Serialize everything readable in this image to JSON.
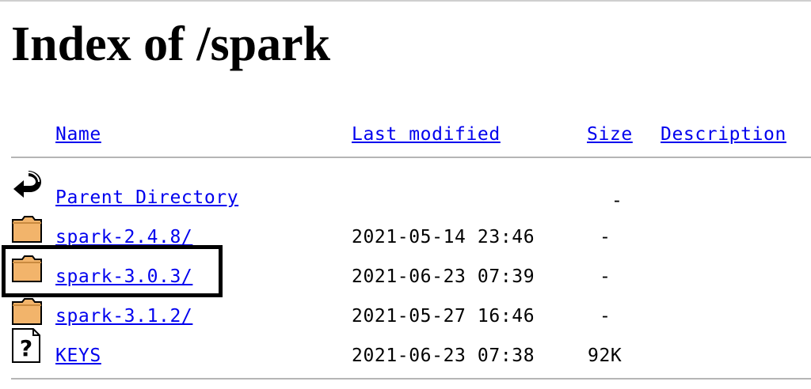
{
  "page": {
    "title": "Index of /spark"
  },
  "header": {
    "name": "Name",
    "last_modified": "Last modified",
    "size": "Size",
    "description": "Description"
  },
  "rows": [
    {
      "icon": "back-arrow-icon",
      "name": "Parent Directory",
      "modified": "",
      "size": "-"
    },
    {
      "icon": "folder-icon",
      "name": "spark-2.4.8/",
      "modified": "2021-05-14 23:46",
      "size": "-"
    },
    {
      "icon": "folder-icon",
      "name": "spark-3.0.3/",
      "modified": "2021-06-23 07:39",
      "size": "-",
      "highlighted": true
    },
    {
      "icon": "folder-icon",
      "name": "spark-3.1.2/",
      "modified": "2021-05-27 16:46",
      "size": "-"
    },
    {
      "icon": "unknown-file-icon",
      "name": "KEYS",
      "modified": "2021-06-23 07:38",
      "size": "92K"
    }
  ],
  "colors": {
    "link": "#0000ee",
    "folder_fill": "#f2b46b",
    "highlight_border": "#000000"
  }
}
